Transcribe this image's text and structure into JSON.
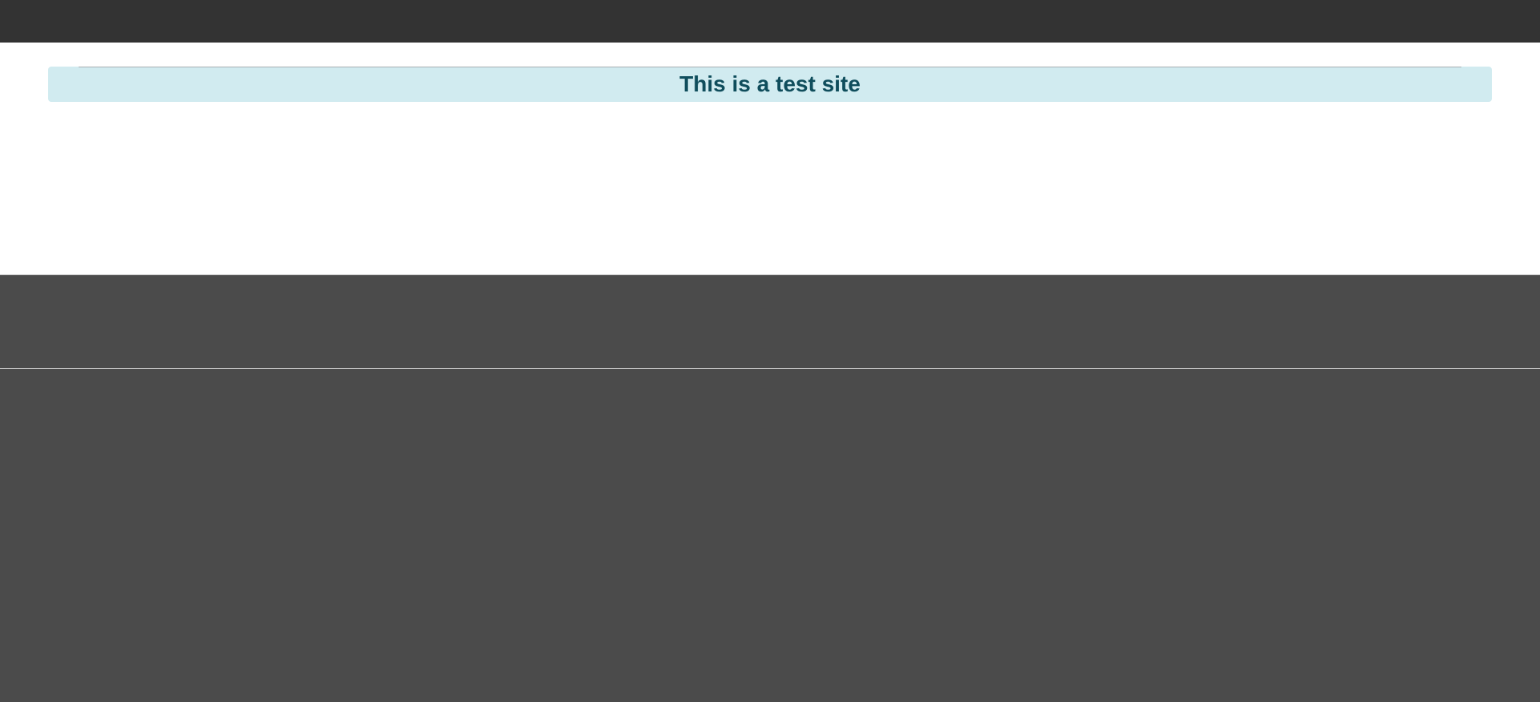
{
  "notice": {
    "title": "This is a test site"
  },
  "colors": {
    "top_bar": "#333333",
    "notice_background": "#d1ebf0",
    "notice_text": "#0f4d5c",
    "footer": "#4b4b4b"
  }
}
